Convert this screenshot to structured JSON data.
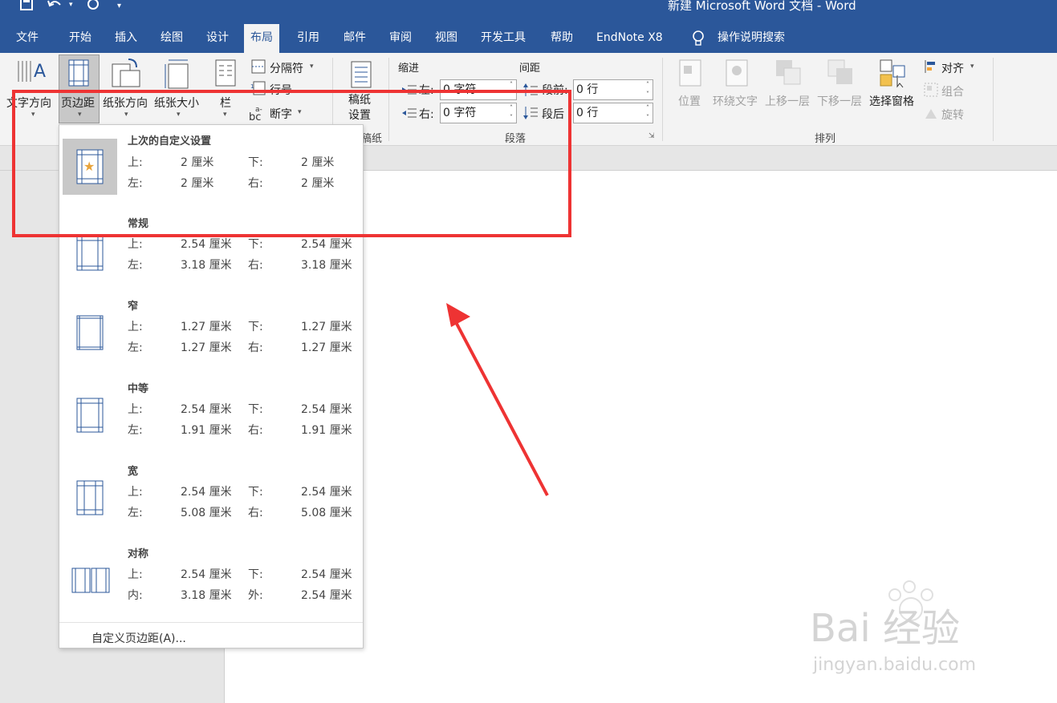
{
  "window": {
    "title": "新建 Microsoft Word 文档  -  Word"
  },
  "menu_tabs": [
    {
      "label": "文件"
    },
    {
      "label": "开始"
    },
    {
      "label": "插入"
    },
    {
      "label": "绘图"
    },
    {
      "label": "设计"
    },
    {
      "label": "布局"
    },
    {
      "label": "引用"
    },
    {
      "label": "邮件"
    },
    {
      "label": "审阅"
    },
    {
      "label": "视图"
    },
    {
      "label": "开发工具"
    },
    {
      "label": "帮助"
    },
    {
      "label": "EndNote X8"
    },
    {
      "label": "操作说明搜索"
    }
  ],
  "ribbon": {
    "page_setup": {
      "text_direction": "文字方向",
      "margins": "页边距",
      "orientation": "纸张方向",
      "size": "纸张大小",
      "columns": "栏",
      "breaks": "分隔符",
      "line_numbers": "行号",
      "hyphenation": "断字"
    },
    "manuscript": {
      "label": "稿纸\n设置",
      "group": "稿纸"
    },
    "paragraph": {
      "indent_header": "缩进",
      "spacing_header": "间距",
      "left_label": "左:",
      "right_label": "右:",
      "left_value": "0 字符",
      "right_value": "0 字符",
      "before_label": "段前:",
      "after_label": "段后",
      "before_value": "0 行",
      "after_value": "0 行",
      "group": "段落"
    },
    "arrange": {
      "position": "位置",
      "wrap": "环绕文字",
      "bring_forward": "上移一层",
      "send_backward": "下移一层",
      "selection_pane": "选择窗格",
      "align": "对齐",
      "group_btn": "组合",
      "rotate": "旋转",
      "group": "排列"
    }
  },
  "margins_dropdown": {
    "presets": [
      {
        "name": "上次的自定义设置",
        "l1": "上:",
        "v1": "2 厘米",
        "l2": "下:",
        "v2": "2 厘米",
        "l3": "左:",
        "v3": "2 厘米",
        "l4": "右:",
        "v4": "2 厘米"
      },
      {
        "name": "常规",
        "l1": "上:",
        "v1": "2.54 厘米",
        "l2": "下:",
        "v2": "2.54 厘米",
        "l3": "左:",
        "v3": "3.18 厘米",
        "l4": "右:",
        "v4": "3.18 厘米"
      },
      {
        "name": "窄",
        "l1": "上:",
        "v1": "1.27 厘米",
        "l2": "下:",
        "v2": "1.27 厘米",
        "l3": "左:",
        "v3": "1.27 厘米",
        "l4": "右:",
        "v4": "1.27 厘米"
      },
      {
        "name": "中等",
        "l1": "上:",
        "v1": "2.54 厘米",
        "l2": "下:",
        "v2": "2.54 厘米",
        "l3": "左:",
        "v3": "1.91 厘米",
        "l4": "右:",
        "v4": "1.91 厘米"
      },
      {
        "name": "宽",
        "l1": "上:",
        "v1": "2.54 厘米",
        "l2": "下:",
        "v2": "2.54 厘米",
        "l3": "左:",
        "v3": "5.08 厘米",
        "l4": "右:",
        "v4": "5.08 厘米"
      },
      {
        "name": "对称",
        "l1": "上:",
        "v1": "2.54 厘米",
        "l2": "下:",
        "v2": "2.54 厘米",
        "l3": "内:",
        "v3": "3.18 厘米",
        "l4": "外:",
        "v4": "2.54 厘米"
      }
    ],
    "custom_label": "自定义页边距(A)..."
  },
  "watermark": {
    "brand": "Bai  经验",
    "url": "jingyan.baidu.com"
  },
  "colors": {
    "title_bar": "#2b579a",
    "annotation_red": "#ee3333"
  }
}
